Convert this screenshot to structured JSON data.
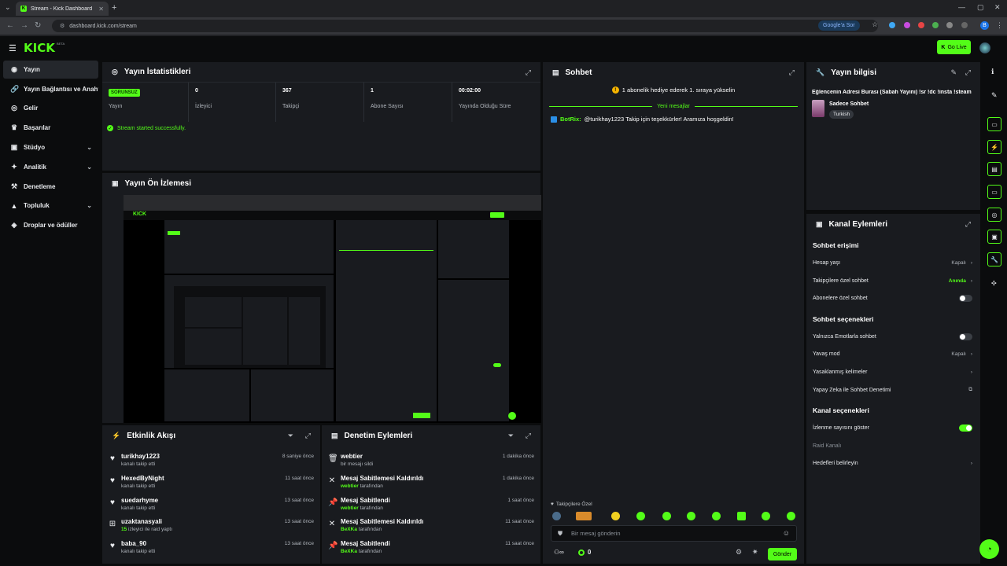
{
  "browser": {
    "tab_title": "Stream - Kick Dashboard",
    "url": "dashboard.kick.com/stream",
    "google_btn": "Google'a Sor",
    "profile_initial": "B"
  },
  "topnav": {
    "logo": "KICK",
    "beta": "BETA",
    "go_live": "Go Live"
  },
  "sidebar": {
    "items": [
      {
        "label": "Yayın",
        "icon": "broadcast-icon"
      },
      {
        "label": "Yayın Bağlantısı ve Anahtarı",
        "icon": "link-icon"
      },
      {
        "label": "Gelir",
        "icon": "revenue-icon"
      },
      {
        "label": "Başarılar",
        "icon": "trophy-icon"
      },
      {
        "label": "Stüdyo",
        "icon": "studio-icon"
      },
      {
        "label": "Analitik",
        "icon": "analytics-icon"
      },
      {
        "label": "Denetleme",
        "icon": "moderation-icon"
      },
      {
        "label": "Topluluk",
        "icon": "community-icon"
      },
      {
        "label": "Droplar ve ödüller",
        "icon": "gift-icon"
      }
    ]
  },
  "stats": {
    "title": "Yayın İstatistikleri",
    "status_badge": "SORUNSUZ",
    "status_label": "Yayın",
    "viewers": "0",
    "viewers_label": "İzleyici",
    "followers": "367",
    "followers_label": "Takipçi",
    "subs": "1",
    "subs_label": "Abone Sayısı",
    "uptime": "00:02:00",
    "uptime_label": "Yayında Olduğu Süre",
    "success_msg": "Stream started successfully."
  },
  "preview": {
    "title": "Yayın Ön İzlemesi"
  },
  "activity": {
    "title": "Etkinlik Akışı",
    "items": [
      {
        "name": "turikhay1223",
        "desc": "kanalı takip etti",
        "time": "8 saniye önce",
        "icon": "heart-icon"
      },
      {
        "name": "HexedByNight",
        "desc": "kanalı takip etti",
        "time": "11 saat önce",
        "icon": "heart-icon"
      },
      {
        "name": "suedarhyme",
        "desc": "kanalı takip etti",
        "time": "13 saat önce",
        "icon": "heart-icon"
      },
      {
        "name": "uzaktanasyali",
        "count": "15",
        "desc": "izleyici ile raid yaptı",
        "time": "13 saat önce",
        "icon": "raid-icon"
      },
      {
        "name": "baba_90",
        "desc": "kanalı takip etti",
        "time": "13 saat önce",
        "icon": "heart-icon"
      }
    ]
  },
  "modlog": {
    "title": "Denetim Eylemleri",
    "items": [
      {
        "title": "webtier",
        "user": "",
        "desc": "bir mesajı sildi",
        "time": "1 dakika önce",
        "icon": "trash-icon"
      },
      {
        "title": "Mesaj Sabitlemesi Kaldırıldı",
        "user": "webtier",
        "desc": "tarafından",
        "time": "1 dakika önce",
        "icon": "unpin-icon"
      },
      {
        "title": "Mesaj Sabitlendi",
        "user": "webtier",
        "desc": "tarafından",
        "time": "1 saat önce",
        "icon": "pin-icon"
      },
      {
        "title": "Mesaj Sabitlemesi Kaldırıldı",
        "user": "BeXKa",
        "desc": "tarafından",
        "time": "11 saat önce",
        "icon": "unpin-icon"
      },
      {
        "title": "Mesaj Sabitlendi",
        "user": "BeXKa",
        "desc": "tarafından",
        "time": "11 saat önce",
        "icon": "pin-icon"
      }
    ]
  },
  "chat": {
    "title": "Sohbet",
    "banner": "1 abonelik hediye ederek 1. sıraya yükselin",
    "new_messages": "Yeni mesajlar",
    "msg_user": "BotRix:",
    "msg_text": "@turikhay1223 Takip için teşekkürler! Aramıza hoşgeldin!",
    "followers_only": "Takipçilere Özel",
    "placeholder": "Bir mesaj gönderin",
    "count": "0",
    "send": "Gönder"
  },
  "streaminfo": {
    "title": "Yayın bilgisi",
    "stream_title": "Eğlencenin Adresi Burası (Sabah Yayını) !sr !dc !insta !steam",
    "category": "Sadece Sohbet",
    "tag": "Turkish"
  },
  "channel": {
    "title": "Kanal Eylemleri",
    "sec_access": "Sohbet erişimi",
    "account_age": "Hesap yaşı",
    "account_age_val": "Kapalı",
    "followers_chat": "Takipçilere özel sohbet",
    "followers_chat_val": "Anında",
    "subs_chat": "Abonelere özel sohbet",
    "sec_options": "Sohbet seçenekleri",
    "emote_only": "Yalnızca Emotlarla sohbet",
    "slow_mode": "Yavaş mod",
    "slow_mode_val": "Kapalı",
    "banned_words": "Yasaklanmış kelimeler",
    "ai_mod": "Yapay Zeka ile Sohbet Denetimi",
    "sec_channel": "Kanal seçenekleri",
    "show_viewers": "İzlenme sayısını göster",
    "raid_channel": "Raid Kanalı",
    "targets": "Hedefleri belirleyin"
  },
  "colors": {
    "accent": "#53fc18",
    "panel": "#191b1f",
    "bg": "#0b0c0d"
  }
}
